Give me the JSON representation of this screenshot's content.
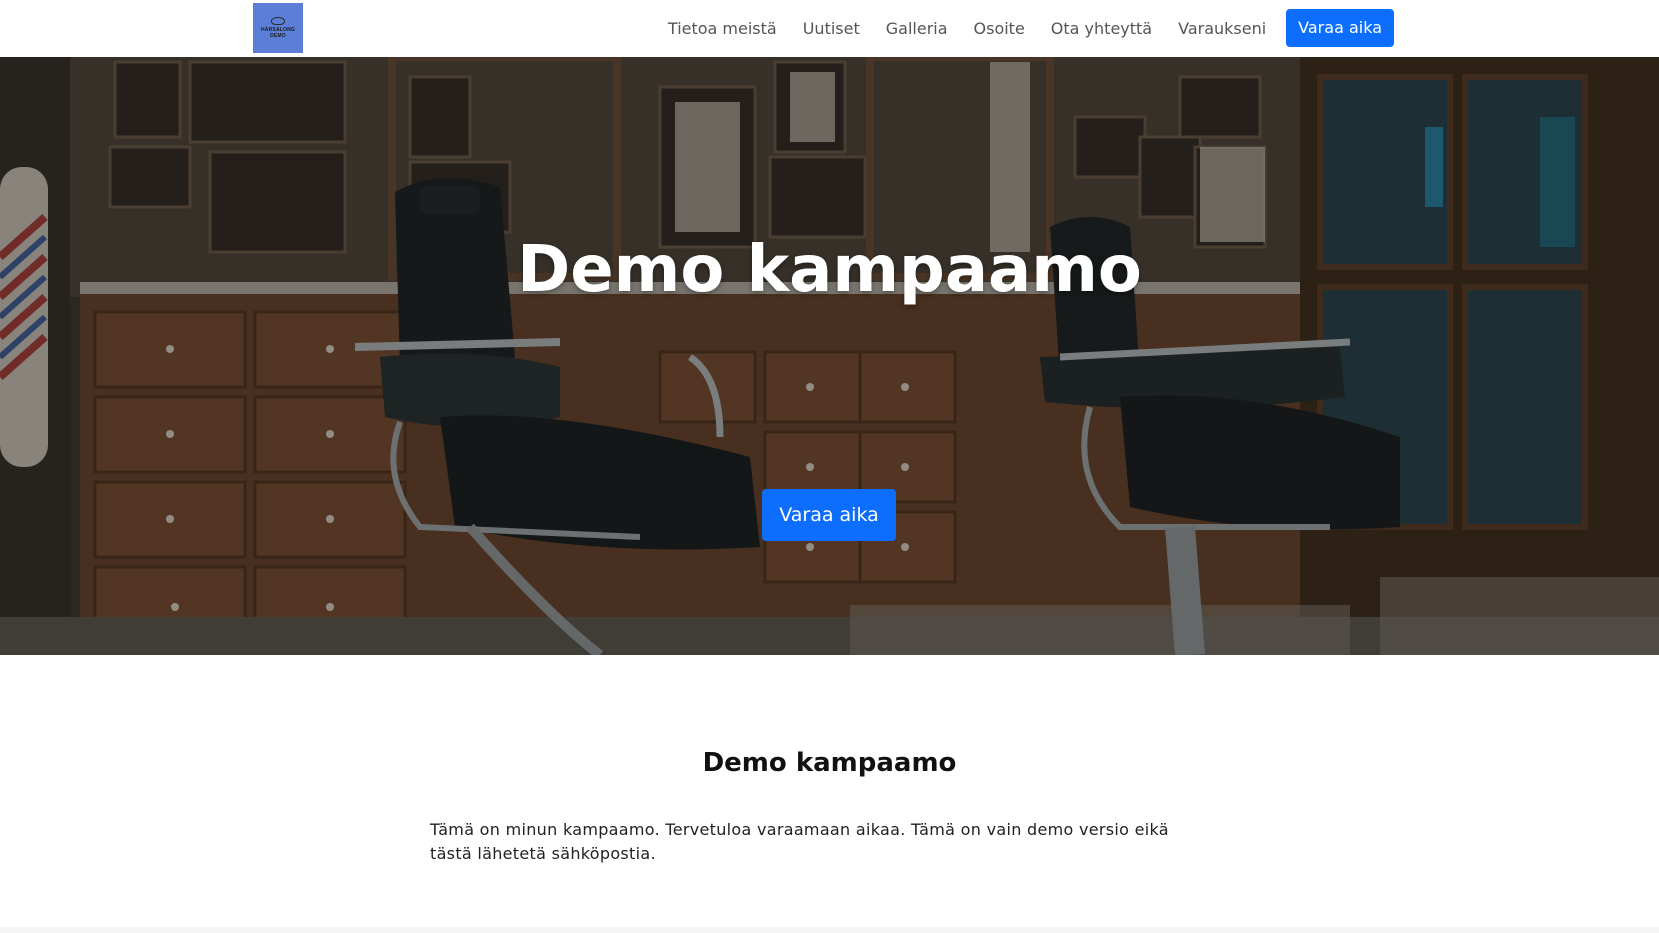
{
  "header": {
    "logo": {
      "text_line1": "HÄRSALONG",
      "text_line2": "DEMO",
      "bg_color": "#5b7fd6"
    },
    "nav": [
      {
        "label": "Tietoa meistä"
      },
      {
        "label": "Uutiset"
      },
      {
        "label": "Galleria"
      },
      {
        "label": "Osoite"
      },
      {
        "label": "Ota yhteyttä"
      },
      {
        "label": "Varaukseni"
      }
    ],
    "cta_label": "Varaa aika"
  },
  "hero": {
    "title": "Demo kampaamo",
    "cta_label": "Varaa aika",
    "image": "barbershop-interior-photo"
  },
  "intro": {
    "heading": "Demo kampaamo",
    "text": "Tämä on minun kampaamo. Tervetuloa varaamaan aikaa. Tämä on vain demo versio eikä tästä lähetetä sähköpostia."
  },
  "colors": {
    "primary": "#0d6efd",
    "nav_text": "#555555",
    "hero_overlay": "#1a1714"
  }
}
